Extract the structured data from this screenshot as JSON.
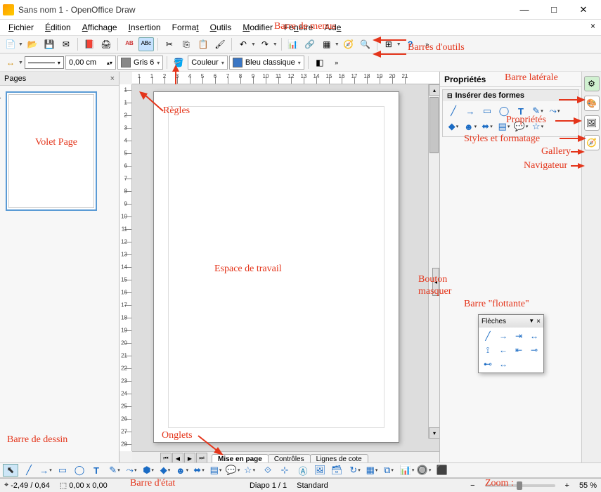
{
  "window": {
    "title": "Sans nom 1 - OpenOffice Draw"
  },
  "menus": [
    "Fichier",
    "Édition",
    "Affichage",
    "Insertion",
    "Format",
    "Outils",
    "Modifier",
    "Fenêtre",
    "Aide"
  ],
  "toolbar2": {
    "width_value": "0,00 cm",
    "gray_label": "Gris 6",
    "color_label": "Couleur",
    "blue_label": "Bleu classique"
  },
  "pages": {
    "title": "Pages",
    "current": "1"
  },
  "tabs": [
    "Mise en page",
    "Contrôles",
    "Lignes de cote"
  ],
  "sidebar": {
    "title": "Propriétés",
    "section": "Insérer des formes"
  },
  "floating": {
    "title": "Flèches"
  },
  "status": {
    "pos": "-2,49 / 0,64",
    "size": "0,00 x 0,00",
    "slide": "Diapo 1 / 1",
    "layout": "Standard",
    "zoom": "55 %"
  },
  "ruler_h": [
    "1",
    "1",
    "2",
    "3",
    "4",
    "5",
    "6",
    "7",
    "8",
    "9",
    "10",
    "11",
    "12",
    "13",
    "14",
    "15",
    "16",
    "17",
    "18",
    "19",
    "20",
    "21"
  ],
  "ruler_v": [
    "1",
    "1",
    "2",
    "3",
    "4",
    "5",
    "6",
    "7",
    "8",
    "9",
    "10",
    "11",
    "12",
    "13",
    "14",
    "15",
    "16",
    "17",
    "18",
    "19",
    "20",
    "21",
    "22",
    "23",
    "24",
    "25",
    "26",
    "27",
    "28"
  ],
  "annotations": {
    "menubar": "Barre de menus",
    "toolbars": "Barres d'outils",
    "rulers": "Règles",
    "pagepanel": "Volet Page",
    "workspace": "Espace de travail",
    "tabs": "Onglets",
    "drawbar": "Barre de dessin",
    "statusbar": "Barre d'état",
    "sidebar": "Barre latérale",
    "props": "Propriétés",
    "styles": "Styles et formatage",
    "gallery": "Gallery",
    "navigator": "Navigateur",
    "hidebtn": "Bouton masquer",
    "floating": "Barre \"flottante\"",
    "zoom": "Zoom :"
  }
}
